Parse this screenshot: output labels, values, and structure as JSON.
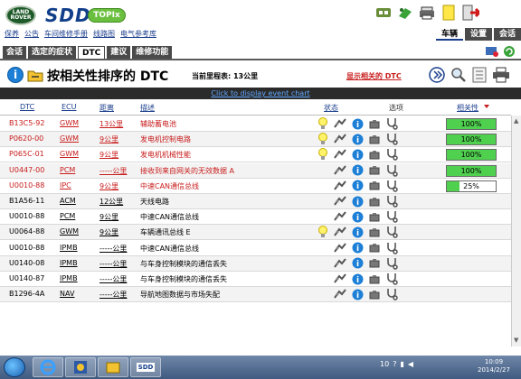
{
  "header": {
    "brand_badge": "LAND ROVER",
    "app_name": "SDD",
    "topix_label": "TOPIx",
    "links": [
      "保养",
      "公告",
      "车间维修手册",
      "线路图",
      "电气参考库"
    ],
    "right_tabs": [
      "车辆",
      "设置",
      "会话"
    ]
  },
  "section_tabs": [
    "会话",
    "选定的症状",
    "DTC",
    "建议",
    "维修功能"
  ],
  "titlebar": {
    "title": "按相关性排序的 DTC",
    "mileage": "当前里程表: 13公里",
    "show_related": "显示相关的 DTC",
    "info_letter": "i"
  },
  "event_chart_link": "Click to display event chart",
  "table": {
    "headers": {
      "dtc": "DTC",
      "ecu": "ECU",
      "distance": "距离",
      "description": "描述",
      "status": "状态",
      "options": "选项",
      "relevance": "相关性"
    },
    "rows": [
      {
        "dtc": "B13C5-92",
        "ecu": "GWM",
        "distance": "13公里",
        "description": "辅助蓄电池",
        "relevance_label": "100%",
        "relevance": 100,
        "highlight": true,
        "bulb": true
      },
      {
        "dtc": "P0620-00",
        "ecu": "GWM",
        "distance": "9公里",
        "description": "发电机控制电路",
        "relevance_label": "100%",
        "relevance": 100,
        "highlight": true,
        "bulb": true
      },
      {
        "dtc": "P065C-01",
        "ecu": "GWM",
        "distance": "9公里",
        "description": "发电机机械性能",
        "relevance_label": "100%",
        "relevance": 100,
        "highlight": true,
        "bulb": true
      },
      {
        "dtc": "U0447-00",
        "ecu": "PCM",
        "distance": "-----公里",
        "description": "接收到来自网关的无效数据 A",
        "relevance_label": "100%",
        "relevance": 100,
        "highlight": true,
        "bulb": false
      },
      {
        "dtc": "U0010-88",
        "ecu": "IPC",
        "distance": "9公里",
        "description": "中速CAN通信总线",
        "relevance_label": "25%",
        "relevance": 25,
        "highlight": true,
        "bulb": false
      },
      {
        "dtc": "B1A56-11",
        "ecu": "ACM",
        "distance": "12公里",
        "description": "天线电路",
        "relevance_label": "",
        "relevance": null,
        "highlight": false,
        "bulb": false
      },
      {
        "dtc": "U0010-88",
        "ecu": "PCM",
        "distance": "9公里",
        "description": "中速CAN通信总线",
        "relevance_label": "",
        "relevance": null,
        "highlight": false,
        "bulb": false
      },
      {
        "dtc": "U0064-88",
        "ecu": "GWM",
        "distance": "9公里",
        "description": "车辆通讯总线 E",
        "relevance_label": "",
        "relevance": null,
        "highlight": false,
        "bulb": true
      },
      {
        "dtc": "U0010-88",
        "ecu": "IPMB",
        "distance": "-----公里",
        "description": "中速CAN通信总线",
        "relevance_label": "",
        "relevance": null,
        "highlight": false,
        "bulb": false
      },
      {
        "dtc": "U0140-08",
        "ecu": "IPMB",
        "distance": "-----公里",
        "description": "与车身控制模块的通信丢失",
        "relevance_label": "",
        "relevance": null,
        "highlight": false,
        "bulb": false
      },
      {
        "dtc": "U0140-87",
        "ecu": "IPMB",
        "distance": "-----公里",
        "description": "与车身控制模块的通信丢失",
        "relevance_label": "",
        "relevance": null,
        "highlight": false,
        "bulb": false
      },
      {
        "dtc": "B1296-4A",
        "ecu": "NAV",
        "distance": "-----公里",
        "description": "导航地图数据与市场失配",
        "relevance_label": "",
        "relevance": null,
        "highlight": false,
        "bulb": false
      }
    ]
  },
  "taskbar": {
    "sdd_label": "SDD",
    "tray_label": "10",
    "time": "10:09",
    "date": "2014/2/27"
  },
  "colors": {
    "highlight_text": "#c81c1c",
    "relevance_fill": "#4fd04f",
    "info_blue": "#1d7fd6",
    "header_dark": "#4a4a4a"
  }
}
